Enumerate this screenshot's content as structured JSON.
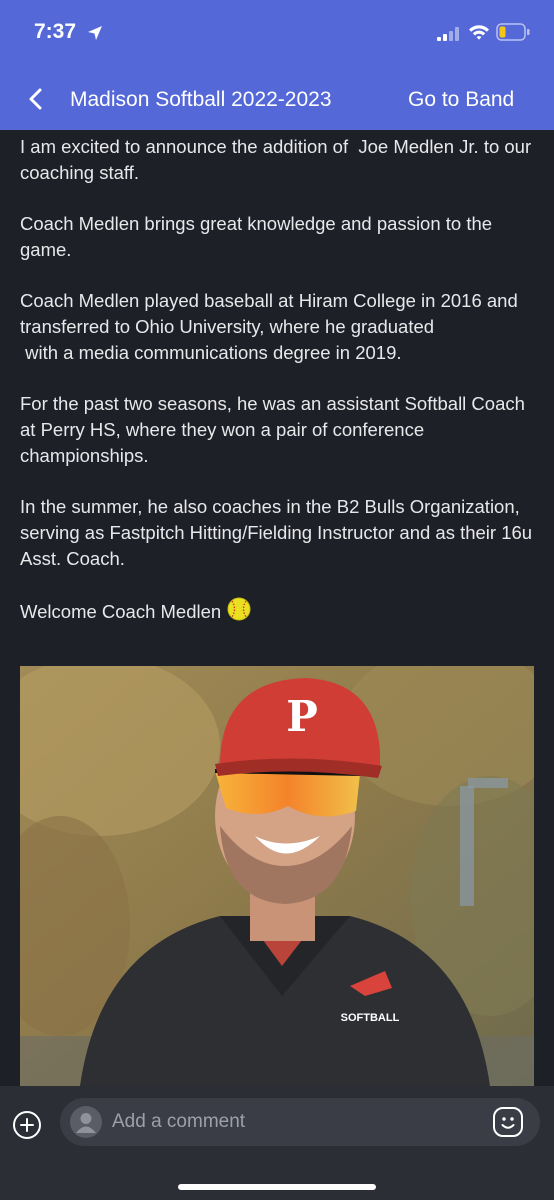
{
  "status_bar": {
    "time": "7:37",
    "icons": [
      "location-arrow-icon",
      "cellular-signal-icon",
      "wifi-icon",
      "battery-low-icon"
    ],
    "battery_color": "#f5c518"
  },
  "header": {
    "back_icon": "chevron-left-icon",
    "title": "Madison Softball 2022-2023",
    "go_to_band_label": "Go to Band",
    "background_color": "#5468d8"
  },
  "post": {
    "paragraphs": [
      "I am excited to announce the addition of  Joe Medlen Jr. to our coaching staff.",
      "Coach Medlen brings great knowledge and passion to the game.",
      "Coach Medlen played baseball at Hiram College in 2016 and transferred to Ohio University, where he graduated\n with a media communications degree in 2019.",
      "For the past two seasons, he was an assistant Softball Coach at Perry HS, where they won a pair of conference championships.",
      "In the summer, he also coaches in the B2 Bulls Organization, serving as Fastpitch Hitting/Fielding Instructor and as their 16u Asst. Coach."
    ],
    "closing": "Welcome Coach Medlen",
    "closing_emoji": "softball-emoji",
    "photo": {
      "cap_letter": "P",
      "jacket_logo_text": "SOFTBALL"
    }
  },
  "comment_bar": {
    "add_icon": "plus-circle-icon",
    "avatar_icon": "default-avatar-icon",
    "placeholder": "Add a comment",
    "emoji_icon": "smiley-icon"
  }
}
